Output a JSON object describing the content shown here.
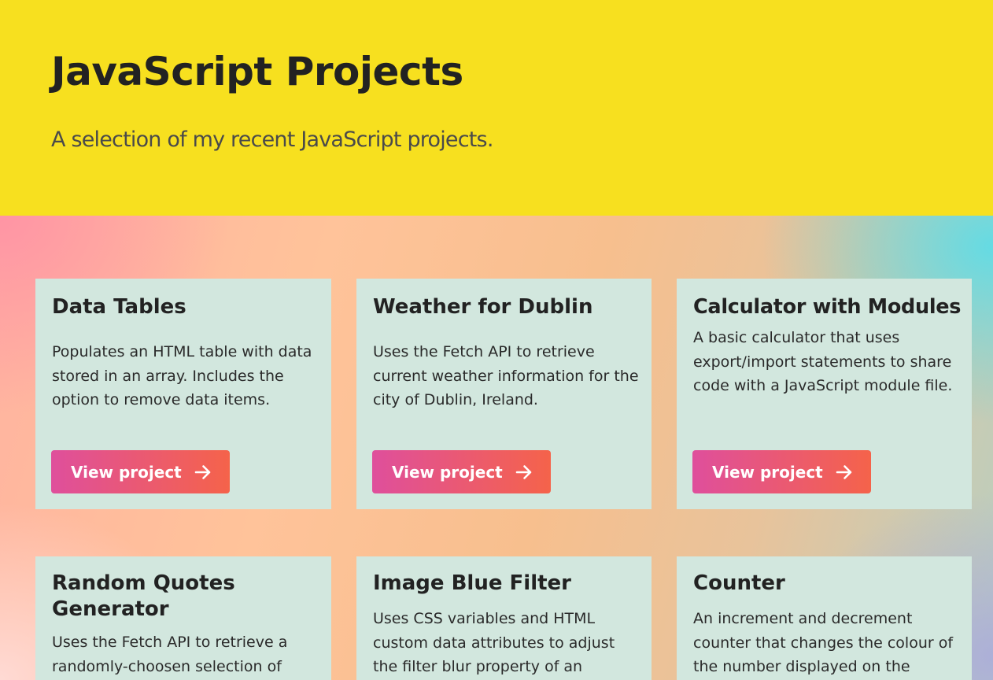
{
  "header": {
    "title": "JavaScript Projects",
    "subtitle": "A selection of my recent JavaScript projects."
  },
  "projects": [
    {
      "title": "Data Tables",
      "description": "Populates an HTML table with data stored in an array. Includes the option to remove data items.",
      "button_label": "View project"
    },
    {
      "title": "Weather for Dublin",
      "description": "Uses the Fetch API to retrieve current weather information for the city of Dublin, Ireland.",
      "button_label": "View project"
    },
    {
      "title": "Calculator with Modules",
      "description": "A basic calculator that uses export/import statements to share code with a JavaScript module file.",
      "button_label": "View project"
    },
    {
      "title": "Random Quotes Generator",
      "description": "Uses the Fetch API to retrieve a randomly-choosen selection of",
      "button_label": ""
    },
    {
      "title": "Image Blue Filter",
      "description": "Uses CSS variables and HTML custom data attributes to adjust the filter blur property of an",
      "button_label": ""
    },
    {
      "title": "Counter",
      "description": "An increment and decrement counter that changes the colour of the number displayed on the",
      "button_label": ""
    }
  ],
  "icons": {
    "button_icon": "arrow-right-icon"
  },
  "colors": {
    "header_background": "#f7e01f",
    "card_background": "#d2e7de",
    "button_gradient_start": "#df4f9c",
    "button_gradient_end": "#f5634a"
  }
}
